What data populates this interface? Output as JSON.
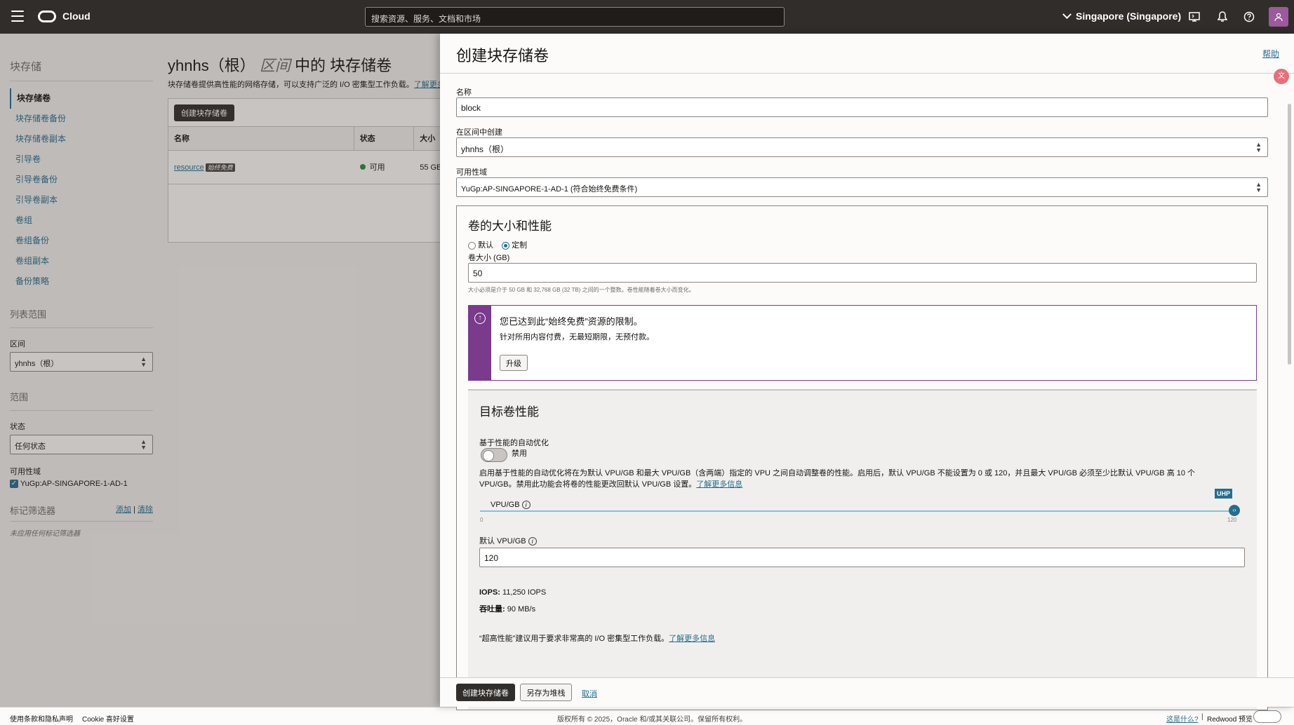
{
  "topbar": {
    "brand": "Cloud",
    "search_placeholder": "搜索资源、服务、文档和市场",
    "region": "Singapore (Singapore)"
  },
  "sidebar": {
    "heading": "块存储",
    "items": [
      "块存储卷",
      "块存储卷备份",
      "块存储卷副本",
      "引导卷",
      "引导卷备份",
      "引导卷副本",
      "卷组",
      "卷组备份",
      "卷组副本",
      "备份策略"
    ],
    "list_scope_heading": "列表范围",
    "compartment_label": "区间",
    "compartment_value": "yhnhs（根）",
    "filters_heading": "范围",
    "state_label": "状态",
    "state_value": "任何状态",
    "ad_label": "可用性域",
    "ad_value": "YuGp:AP-SINGAPORE-1-AD-1",
    "tag_filter_heading": "标记筛选器",
    "tag_add": "添加",
    "tag_clear": "清除",
    "tag_none": "未应用任何标记筛选器"
  },
  "main": {
    "title_prefix": "yhnhs（根）",
    "title_scope": "区间",
    "title_suffix": "中的 块存储卷",
    "description": "块存储卷提供高性能的网络存储，可以支持广泛的 I/O 密集型工作负载。",
    "learn_more": "了解更多",
    "create_button": "创建块存储卷",
    "columns": [
      "名称",
      "状态",
      "大小"
    ],
    "rows": [
      {
        "name": "resource",
        "badge": "始终免费",
        "state": "可用",
        "size": "55 GB"
      }
    ]
  },
  "drawer": {
    "title": "创建块存储卷",
    "help": "帮助",
    "name_label": "名称",
    "name_value": "block",
    "compartment_label": "在区间中创建",
    "compartment_value": "yhnhs（根）",
    "ad_label": "可用性域",
    "ad_value": "YuGp:AP-SINGAPORE-1-AD-1 (符合始终免费条件)",
    "size_section_title": "卷的大小和性能",
    "radio_default": "默认",
    "radio_custom": "定制",
    "size_label": "卷大小 (GB)",
    "size_value": "50",
    "size_hint": "大小必须是介于 50 GB 和 32,768 GB (32 TB) 之间的一个整数。卷性能随着卷大小而变化。",
    "notice_title": "您已达到此“始终免费”资源的限制。",
    "notice_body": "针对所用内容付费，无最短期限，无预付款。",
    "notice_button": "升级",
    "perf_title": "目标卷性能",
    "autotune_label": "基于性能的自动优化",
    "autotune_state": "禁用",
    "autotune_desc_1": "启用基于性能的自动优化将在为默认 VPU/GB 和最大 VPU/GB（含两端）指定的 VPU 之间自动调整卷的性能。启用后，默认 VPU/GB 不能设置为 0 或 120，并且最大 VPU/GB 必须至少比默认 VPU/GB 高 10 个",
    "autotune_desc_2": "VPU/GB。禁用此功能会将卷的性能更改回默认 VPU/GB 设置。",
    "learn_more": "了解更多信息",
    "vpu_label": "VPU/GB",
    "uhp_badge": "UHP",
    "slider_min": "0",
    "slider_max": "120",
    "slider_value_fraction": 1.0,
    "default_vpu_label": "默认 VPU/GB",
    "default_vpu_value": "120",
    "iops_label": "IOPS:",
    "iops_value": "11,250 IOPS",
    "throughput_label": "吞吐量:",
    "throughput_value": "90 MB/s",
    "uhp_note": "“超高性能”建议用于要求非常高的 I/O 密集型工作负载。",
    "create_button": "创建块存储卷",
    "save_stack_button": "另存为堆栈",
    "cancel_link": "取消"
  },
  "footer": {
    "terms": "使用条款和隐私声明",
    "cookies": "Cookie 喜好设置",
    "copyright": "版权所有 © 2025，Oracle 和/或其关联公司。保留所有权利。",
    "whats_this": "这是什么?",
    "redwood": "Redwood 预览"
  },
  "colors": {
    "topbar": "#312d2a",
    "accent": "#246e8f",
    "notice": "#7a3b8c",
    "available": "#2d8a3e"
  }
}
